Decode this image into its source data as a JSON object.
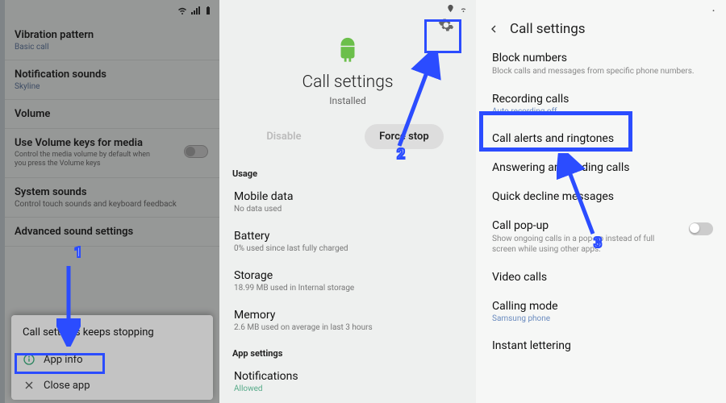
{
  "panel1": {
    "items": [
      {
        "title": "Vibration pattern",
        "sub": "Basic call"
      },
      {
        "title": "Notification sounds",
        "sub": "Skyline"
      },
      {
        "title": "Volume"
      },
      {
        "title": "Use Volume keys for media",
        "sub": "Control the media volume by default when you press the Volume keys",
        "toggle": true
      },
      {
        "title": "System sounds",
        "sub": "Control touch sounds and keyboard feedback"
      },
      {
        "title": "Advanced sound settings"
      }
    ],
    "dialog": {
      "title": "Call settings keeps stopping",
      "app_info": "App info",
      "close_app": "Close app"
    },
    "badge": "1"
  },
  "panel2": {
    "app_title": "Call settings",
    "app_sub": "Installed",
    "btn_disable": "Disable",
    "btn_force": "Force stop",
    "section": "Usage",
    "items": [
      {
        "title": "Mobile data",
        "sub": "No data used"
      },
      {
        "title": "Battery",
        "sub": "0% used since last fully charged"
      },
      {
        "title": "Storage",
        "sub": "18.99 MB used in Internal storage"
      },
      {
        "title": "Memory",
        "sub": "2.6 MB used on average in last 3 hours"
      }
    ],
    "section2": "App settings",
    "notif": {
      "title": "Notifications",
      "sub": "Allowed"
    },
    "badge": "2"
  },
  "panel3": {
    "header": "Call settings",
    "items": [
      {
        "title": "Block numbers",
        "sub": "Block calls and messages from specific phone numbers."
      },
      {
        "title": "Recording calls",
        "sub": "Auto recording off",
        "highlight": true
      },
      {
        "title": "Call alerts and ringtones"
      },
      {
        "title": "Answering and ending calls"
      },
      {
        "title": "Quick decline messages"
      },
      {
        "title": "Call pop-up",
        "sub": "Show ongoing calls in a pop-up instead of full screen while using other apps.",
        "toggle": true
      },
      {
        "title": "Video calls"
      },
      {
        "title": "Calling mode",
        "sub2": "Samsung phone"
      },
      {
        "title": "Instant lettering"
      }
    ],
    "badge": "3"
  }
}
